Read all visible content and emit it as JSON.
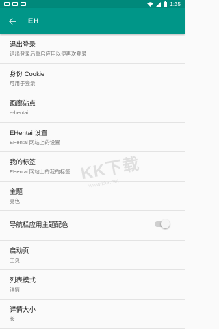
{
  "status_bar": {
    "time": "1:35"
  },
  "app_bar": {
    "title": "EH"
  },
  "settings": [
    {
      "title": "退出登录",
      "summary": "退出登录后重启应用以便再次登录"
    },
    {
      "title": "身份 Cookie",
      "summary": "可用于登录"
    },
    {
      "title": "画廊站点",
      "summary": "e-hentai"
    },
    {
      "title": "EHentai 设置",
      "summary": "EHentai 网站上的设置"
    },
    {
      "title": "我的标签",
      "summary": "EHentai 网站上的我的标签"
    },
    {
      "title": "主题",
      "summary": "亮色"
    },
    {
      "title": "导航栏应用主题配色",
      "switch_on": false
    },
    {
      "title": "启动页",
      "summary": "主页"
    },
    {
      "title": "列表模式",
      "summary": "详情"
    },
    {
      "title": "详情大小",
      "summary": "长"
    }
  ],
  "watermark": {
    "brand": "KK下载",
    "url": "www.kkx.net"
  },
  "colors": {
    "primary": "#009688",
    "primary_dark": "#00897b"
  }
}
